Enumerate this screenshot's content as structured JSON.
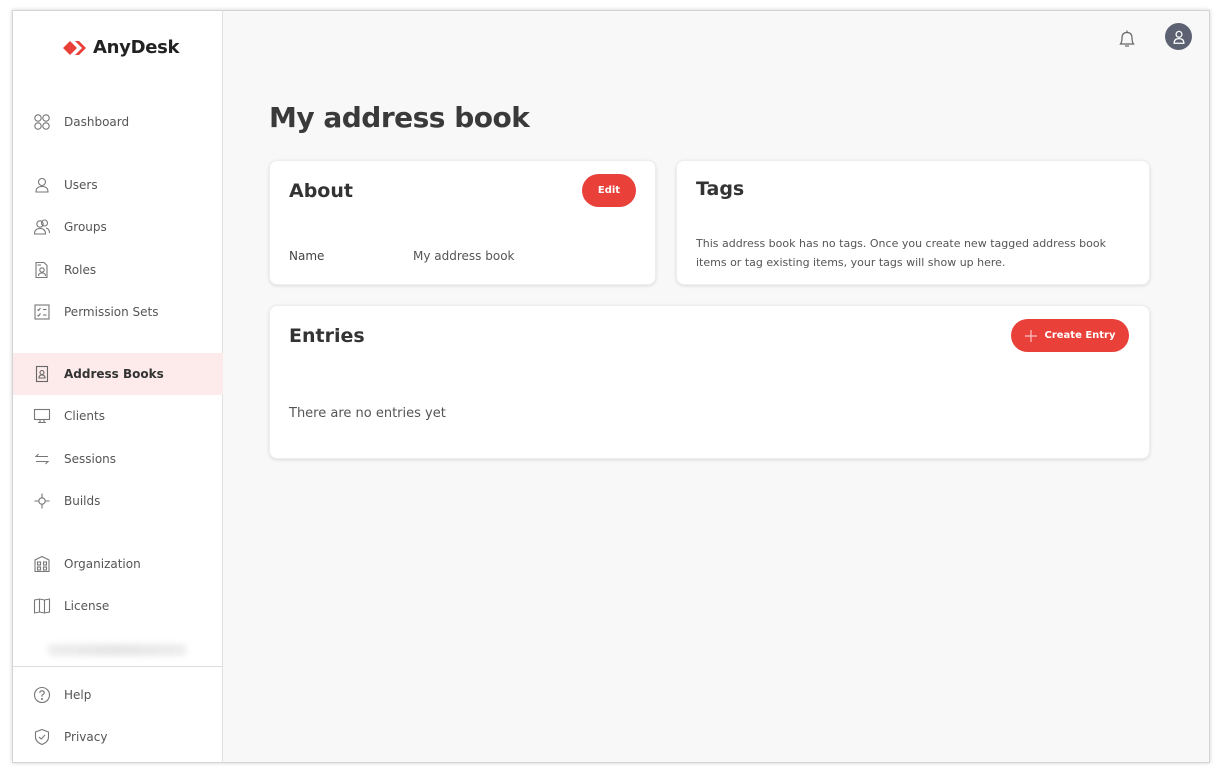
{
  "brand": {
    "name": "AnyDesk",
    "accent": "#e9403a"
  },
  "sidebar": {
    "items": [
      {
        "label": "Dashboard",
        "icon": "dashboard-icon"
      },
      {
        "label": "Users",
        "icon": "user-icon"
      },
      {
        "label": "Groups",
        "icon": "users-icon"
      },
      {
        "label": "Roles",
        "icon": "role-icon"
      },
      {
        "label": "Permission Sets",
        "icon": "checklist-icon"
      },
      {
        "label": "Address Books",
        "icon": "address-book-icon",
        "active": true
      },
      {
        "label": "Clients",
        "icon": "monitor-icon"
      },
      {
        "label": "Sessions",
        "icon": "arrows-icon"
      },
      {
        "label": "Builds",
        "icon": "build-icon"
      },
      {
        "label": "Organization",
        "icon": "building-icon"
      },
      {
        "label": "License",
        "icon": "book-icon"
      }
    ],
    "footer_items": [
      {
        "label": "Help",
        "icon": "help-icon"
      },
      {
        "label": "Privacy",
        "icon": "shield-icon"
      }
    ]
  },
  "header": {
    "notifications_icon": "bell-icon",
    "avatar_icon": "user-avatar-icon"
  },
  "page": {
    "title": "My address book"
  },
  "about": {
    "title": "About",
    "edit_label": "Edit",
    "fields": [
      {
        "label": "Name",
        "value": "My address book"
      }
    ]
  },
  "tags": {
    "title": "Tags",
    "empty_text": "This address book has no tags. Once you create new tagged address book items or tag existing items, your tags will show up here."
  },
  "entries": {
    "title": "Entries",
    "create_label": "Create Entry",
    "empty_text": "There are no entries yet"
  }
}
